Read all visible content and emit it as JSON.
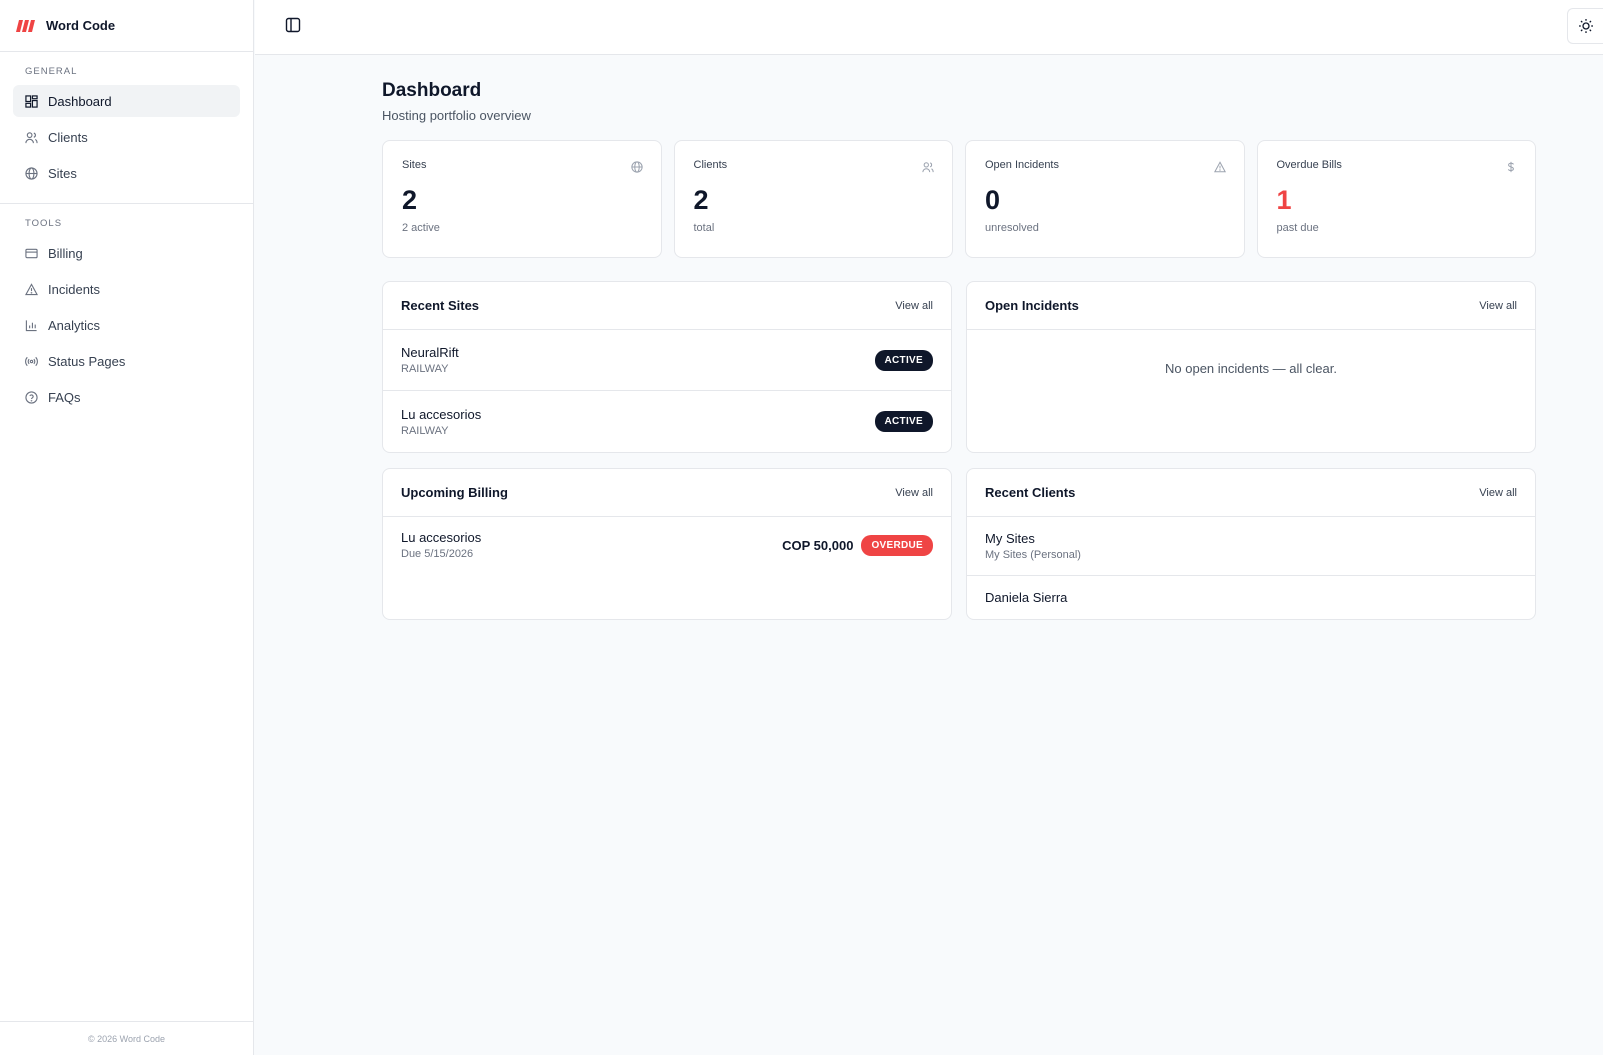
{
  "brand": {
    "name": "Word Code",
    "logo_color": "#ef4444"
  },
  "sidebar": {
    "general_title": "GENERAL",
    "general_items": [
      {
        "label": "Dashboard",
        "icon": "dashboard-icon",
        "active": true
      },
      {
        "label": "Clients",
        "icon": "users-icon"
      },
      {
        "label": "Sites",
        "icon": "globe-icon"
      }
    ],
    "tools_title": "TOOLS",
    "tools_items": [
      {
        "label": "Billing",
        "icon": "credit-card-icon"
      },
      {
        "label": "Incidents",
        "icon": "alert-triangle-icon"
      },
      {
        "label": "Analytics",
        "icon": "bar-chart-icon"
      },
      {
        "label": "Status Pages",
        "icon": "radio-icon"
      },
      {
        "label": "FAQs",
        "icon": "help-circle-icon"
      }
    ],
    "footer": "© 2026 Word Code"
  },
  "topbar": {
    "toggle_icon": "panel-left-icon",
    "theme_icon": "sun-icon"
  },
  "page": {
    "title": "Dashboard",
    "subtitle": "Hosting portfolio overview"
  },
  "stats": [
    {
      "label": "Sites",
      "value": "2",
      "sub": "2 active",
      "icon": "globe-icon"
    },
    {
      "label": "Clients",
      "value": "2",
      "sub": "total",
      "icon": "users-icon"
    },
    {
      "label": "Open Incidents",
      "value": "0",
      "sub": "unresolved",
      "icon": "alert-triangle-icon"
    },
    {
      "label": "Overdue Bills",
      "value": "1",
      "sub": "past due",
      "icon": "dollar-icon",
      "value_color": "#ef4444"
    }
  ],
  "recent_sites": {
    "title": "Recent Sites",
    "view_all": "View all",
    "rows": [
      {
        "name": "NeuralRift",
        "provider": "RAILWAY",
        "status": "ACTIVE"
      },
      {
        "name": "Lu accesorios",
        "provider": "RAILWAY",
        "status": "ACTIVE"
      }
    ]
  },
  "open_incidents": {
    "title": "Open Incidents",
    "view_all": "View all",
    "empty": "No open incidents — all clear."
  },
  "upcoming_billing": {
    "title": "Upcoming Billing",
    "view_all": "View all",
    "rows": [
      {
        "name": "Lu accesorios",
        "due": "Due 5/15/2026",
        "amount": "COP 50,000",
        "status": "OVERDUE"
      }
    ]
  },
  "recent_clients": {
    "title": "Recent Clients",
    "view_all": "View all",
    "rows": [
      {
        "name": "My Sites",
        "sub": "My Sites (Personal)"
      },
      {
        "name": "Daniela Sierra"
      }
    ]
  }
}
